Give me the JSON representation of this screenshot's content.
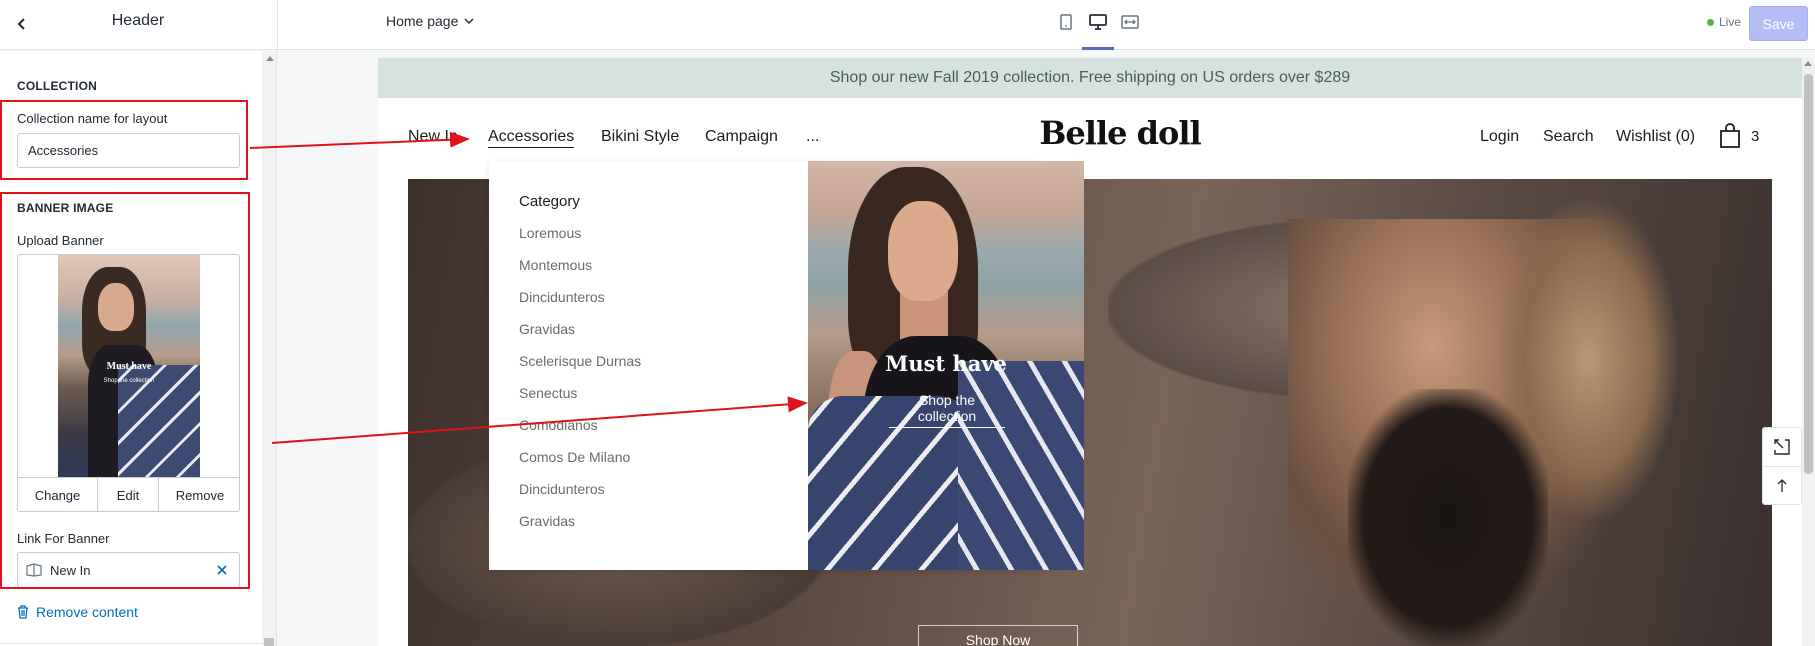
{
  "editor": {
    "panel_title": "Header",
    "page_selector": "Home page",
    "live_label": "Live",
    "save_label": "Save",
    "colors": {
      "accent": "#5c6ac4",
      "live": "#50b83c",
      "save": "#b3bcf5",
      "annotation": "#e0131a",
      "link": "#006fbb"
    }
  },
  "collection": {
    "heading": "COLLECTION",
    "name_label": "Collection name for layout",
    "name_value": "Accessories"
  },
  "banner": {
    "heading": "BANNER IMAGE",
    "upload_label": "Upload Banner",
    "thumb_title": "Must have",
    "thumb_subtitle": "Shop the collection",
    "actions": {
      "change": "Change",
      "edit": "Edit",
      "remove": "Remove"
    },
    "link_label": "Link For Banner",
    "link_value": "New In",
    "remove_content": "Remove content"
  },
  "store": {
    "announcement": "Shop our new Fall 2019 collection. Free shipping on US orders over $289",
    "nav": [
      "New In",
      "Accessories",
      "Bikini Style",
      "Campaign",
      "..."
    ],
    "logo": "Belle doll",
    "header_links": {
      "login": "Login",
      "search": "Search",
      "wishlist": "Wishlist (0)"
    },
    "cart_count": "3",
    "hero_cta": "Shop Now",
    "mega_menu": {
      "heading": "Category",
      "items": [
        "Loremous",
        "Montemous",
        "Dincidunteros",
        "Gravidas",
        "Scelerisque Durnas",
        "Senectus",
        "Comodianos",
        "Comos De Milano",
        "Dincidunteros",
        "Gravidas"
      ],
      "banner_title": "Must have",
      "banner_link": "Shop the collection"
    }
  }
}
